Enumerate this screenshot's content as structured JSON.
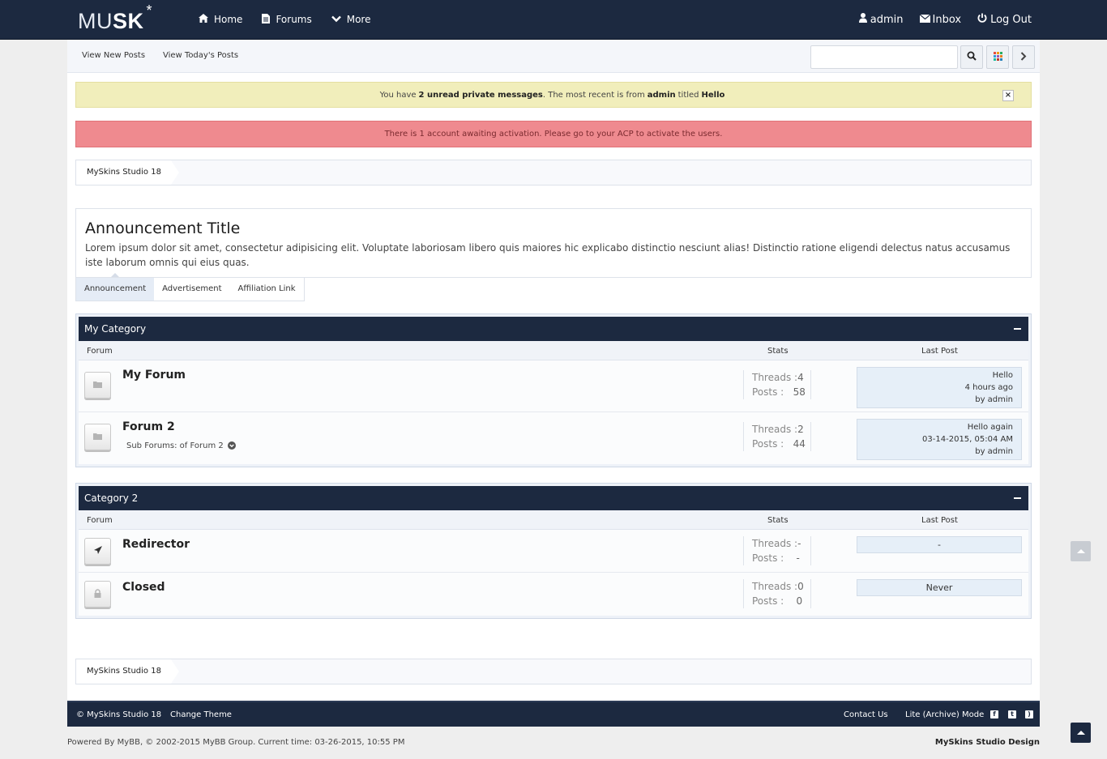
{
  "topbar": {
    "logo_thin": "MU",
    "logo_bold": "SK",
    "logo_star": "*",
    "nav": [
      {
        "label": "Home",
        "icon": "home-icon"
      },
      {
        "label": "Forums",
        "icon": "document-icon"
      },
      {
        "label": "More",
        "icon": "chevron-down-icon"
      }
    ],
    "user": {
      "label": "admin",
      "icon": "user-icon"
    },
    "inbox": {
      "label": "Inbox",
      "icon": "envelope-icon"
    },
    "logout": {
      "label": "Log Out",
      "icon": "power-icon"
    }
  },
  "subbar": {
    "new_posts": "View New Posts",
    "todays_posts": "View Today's Posts",
    "search_placeholder": ""
  },
  "alerts": {
    "pm_prefix": "You have",
    "pm_count": "2 unread private messages",
    "pm_middle": ". The most recent is from",
    "pm_from": "admin",
    "pm_titled": "titled",
    "pm_title": "Hello",
    "pm_close": "×",
    "activation": "There is 1 account awaiting activation. Please go to your ACP to activate the users."
  },
  "breadcrumb": {
    "label": "MySkins Studio 18"
  },
  "announcement": {
    "title": "Announcement Title",
    "body": "Lorem ipsum dolor sit amet, consectetur adipisicing elit. Voluptate laboriosam libero quis maiores hic explicabo distinctio nesciunt alias! Distinctio ratione eligendi delectus natus accusamus iste laborum omnis qui eius quas.",
    "tabs": [
      "Announcement",
      "Advertisement",
      "Affiliation Link"
    ]
  },
  "columns": {
    "forum": "Forum",
    "stats": "Stats",
    "last_post": "Last Post"
  },
  "categories": [
    {
      "name": "My Category",
      "forums": [
        {
          "name": "My Forum",
          "threads_label": "Threads :",
          "threads": "4",
          "posts_label": "Posts :",
          "posts": "58",
          "last_title": "Hello",
          "last_time": "4 hours ago",
          "last_by": "by admin"
        },
        {
          "name": "Forum 2",
          "subforums": "Sub Forums: of Forum 2",
          "threads_label": "Threads :",
          "threads": "2",
          "posts_label": "Posts :",
          "posts": "44",
          "last_title": "Hello again",
          "last_time": "03-14-2015, 05:04 AM",
          "last_by": "by admin"
        }
      ]
    },
    {
      "name": "Category 2",
      "forums": [
        {
          "name": "Redirector",
          "threads_label": "Threads :",
          "threads": "-",
          "posts_label": "Posts :",
          "posts": "-",
          "last_text": "-"
        },
        {
          "name": "Closed",
          "threads_label": "Threads :",
          "threads": "0",
          "posts_label": "Posts :",
          "posts": "0",
          "last_text": "Never"
        }
      ]
    }
  ],
  "footer": {
    "copyright": "© MySkins Studio 18",
    "change_theme": "Change Theme",
    "contact": "Contact Us",
    "lite_mode": "Lite (Archive) Mode",
    "powered_prefix": "Powered By",
    "mybb": "MyBB",
    "powered_mid": ", © 2002-2015",
    "mybb_group": "MyBB Group",
    "current_time": ". Current time: 03-26-2015, 10:55 PM",
    "credit": "MySkins Studio Design"
  },
  "colors": {
    "navy": "#1c2940",
    "alert_yellow": "#f1eebb",
    "alert_red": "#ef8a8f",
    "lastpost_bg": "#e6eff8"
  }
}
